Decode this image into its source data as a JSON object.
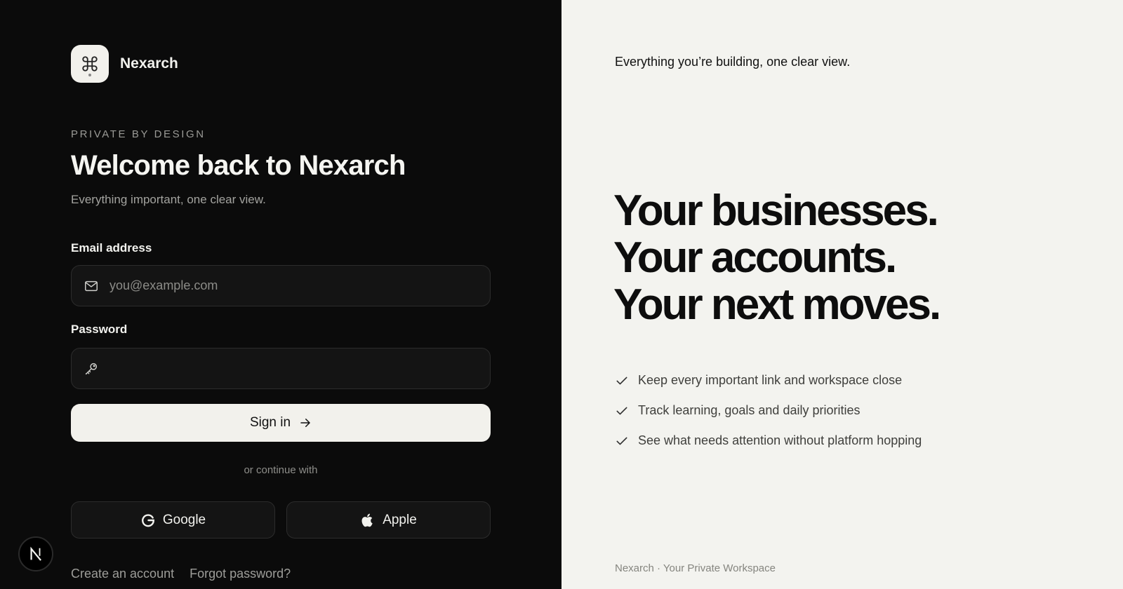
{
  "brand": {
    "name": "Nexarch",
    "logo_icon": "command-key-icon"
  },
  "login": {
    "eyebrow": "PRIVATE BY DESIGN",
    "title": "Welcome back to Nexarch",
    "subtitle": "Everything important, one clear view.",
    "email": {
      "label": "Email address",
      "placeholder": "you@example.com",
      "value": "",
      "icon": "mail-icon"
    },
    "password": {
      "label": "Password",
      "placeholder": "",
      "value": "",
      "icon": "key-icon"
    },
    "signin_label": "Sign in",
    "divider": "or continue with",
    "social": {
      "google": "Google",
      "apple": "Apple"
    },
    "links": {
      "create": "Create an account",
      "forgot": "Forgot password?"
    }
  },
  "showcase": {
    "tagline": "Everything you’re building, one clear view.",
    "headline": [
      "Your businesses.",
      "Your accounts.",
      "Your next moves."
    ],
    "features": [
      "Keep every important link and workspace close",
      "Track learning, goals and daily priorities",
      "See what needs attention without platform hopping"
    ],
    "footer": "Nexarch · Your Private Workspace"
  },
  "colors": {
    "dark_bg": "#0b0b0b",
    "light_bg": "#f3f3ef",
    "button_bg": "#f2f1ec"
  }
}
